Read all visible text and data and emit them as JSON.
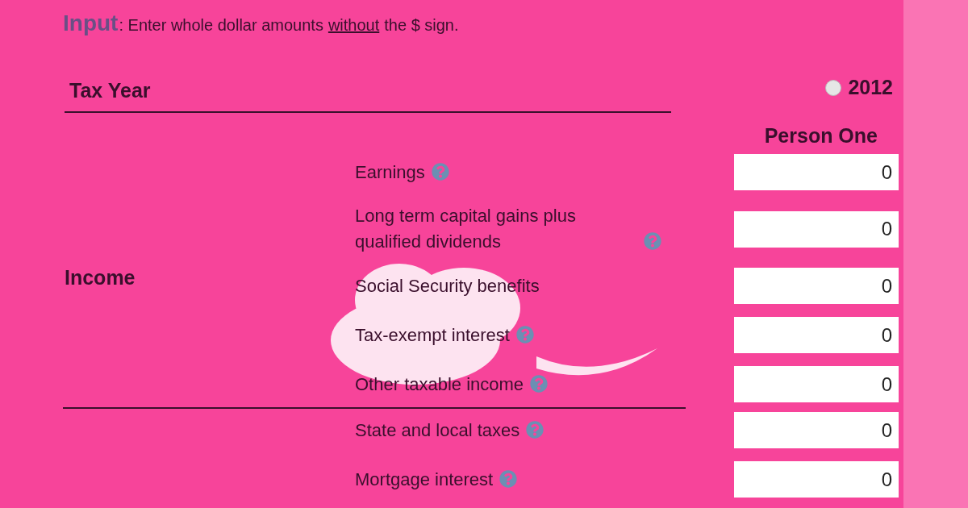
{
  "header": {
    "title": "Input",
    "note_before": ": Enter whole dollar amounts",
    "note_link": "without",
    "note_after": "the $ sign."
  },
  "tax_year": {
    "label": "Tax Year",
    "options": [
      {
        "label": "2012",
        "selected": false
      }
    ]
  },
  "column_heading": "Person One",
  "sections": [
    {
      "label": "Income",
      "rows": [
        {
          "label": "Earnings",
          "help": true,
          "value": "0"
        },
        {
          "label": "Long term capital gains plus qualified dividends",
          "help": true,
          "value": "0"
        },
        {
          "label": "Social Security benefits",
          "help": false,
          "value": "0"
        },
        {
          "label": "Tax-exempt interest",
          "help": true,
          "value": "0"
        },
        {
          "label": "Other taxable income",
          "help": true,
          "value": "0"
        }
      ]
    },
    {
      "rows": [
        {
          "label": "State and local taxes",
          "help": true,
          "value": "0"
        },
        {
          "label": "Mortgage interest",
          "help": true,
          "value": "0"
        }
      ]
    }
  ]
}
